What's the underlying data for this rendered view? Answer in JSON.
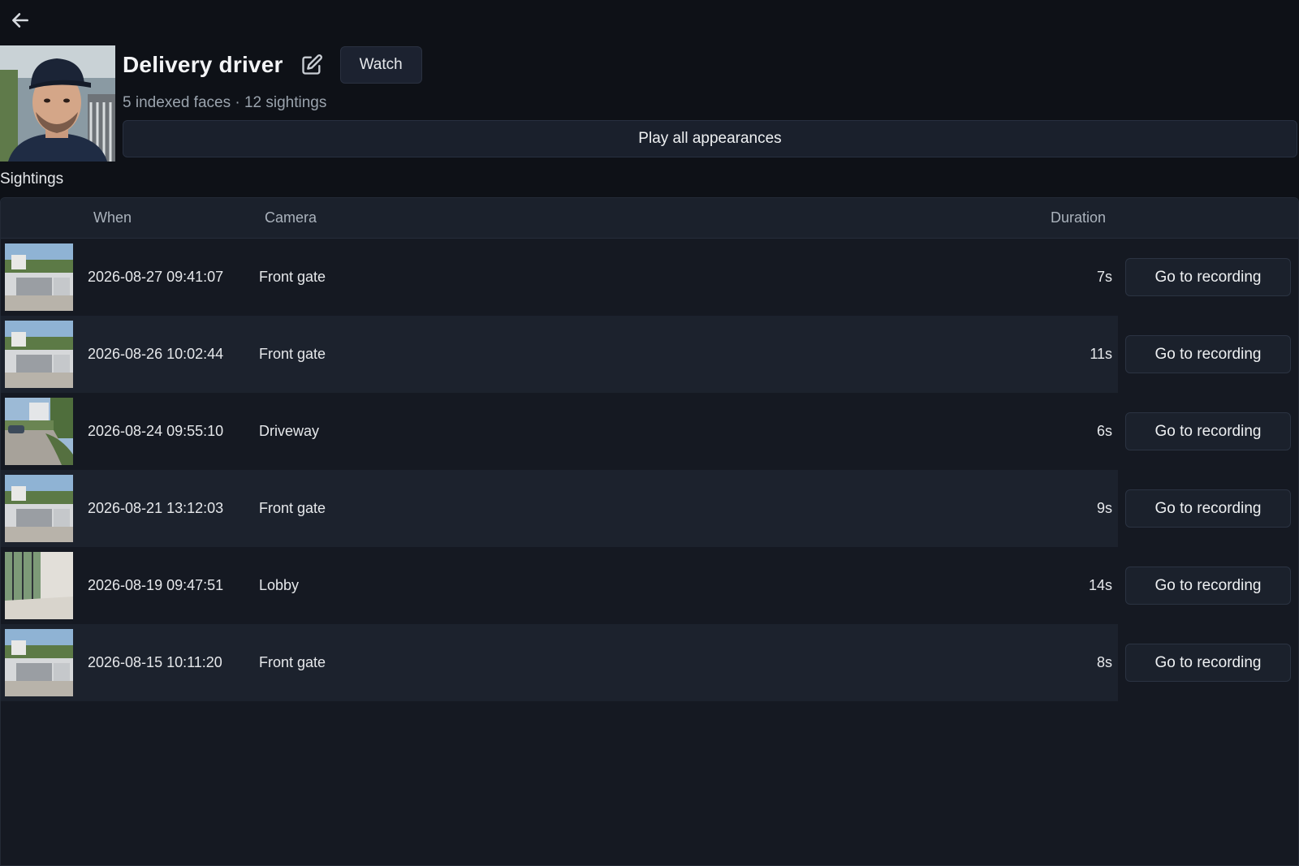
{
  "nav": {
    "back_icon": "arrow-left-icon"
  },
  "person": {
    "name": "Delivery driver",
    "edit_icon": "edit-icon",
    "watch_label": "Watch",
    "summary": "5 indexed faces · 12 sightings",
    "play_all_label": "Play all appearances"
  },
  "sightings": {
    "title": "Sightings",
    "columns": {
      "when": "When",
      "camera": "Camera",
      "duration": "Duration"
    },
    "action_label": "Go to recording",
    "rows": [
      {
        "when": "2026-08-27 09:41:07",
        "camera": "Front gate",
        "duration": "7s"
      },
      {
        "when": "2026-08-26 10:02:44",
        "camera": "Front gate",
        "duration": "11s"
      },
      {
        "when": "2026-08-24 09:55:10",
        "camera": "Driveway",
        "duration": "6s"
      },
      {
        "when": "2026-08-21 13:12:03",
        "camera": "Front gate",
        "duration": "9s"
      },
      {
        "when": "2026-08-19 09:47:51",
        "camera": "Lobby",
        "duration": "14s"
      },
      {
        "when": "2026-08-15 10:11:20",
        "camera": "Front gate",
        "duration": "8s"
      }
    ]
  },
  "colors": {
    "background": "#0e1117",
    "panel": "#151922",
    "row_alt": "#1c222d",
    "text": "#e6e8eb",
    "muted": "#9aa3ad"
  }
}
